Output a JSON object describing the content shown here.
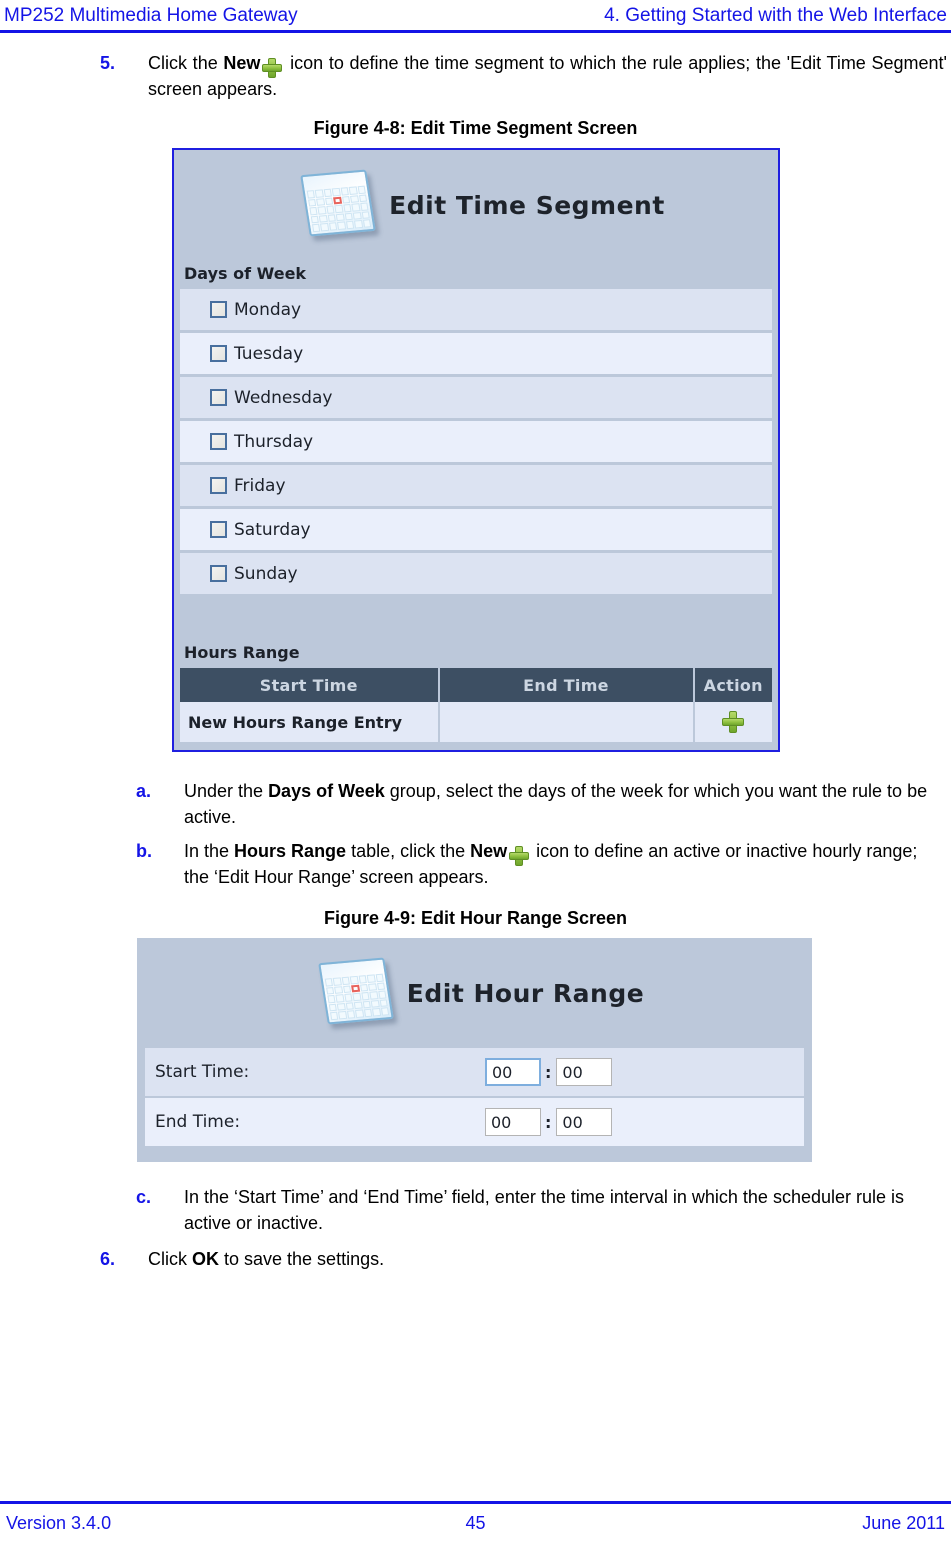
{
  "header": {
    "left": "MP252 Multimedia Home Gateway",
    "right": "4. Getting Started with the Web Interface"
  },
  "footer": {
    "version": "Version 3.4.0",
    "page_number": "45",
    "date": "June 2011"
  },
  "steps": {
    "step5": {
      "marker": "5.",
      "text_before_bold": "Click the ",
      "bold": "New",
      "text_after": " icon to define the time segment to which the rule applies; the 'Edit Time Segment' screen appears."
    },
    "step_a": {
      "marker": "a.",
      "text_before_bold": "Under the ",
      "bold": "Days of Week",
      "text_after": " group, select the days of the week for which you want the rule to be active."
    },
    "step_b": {
      "marker": "b.",
      "text_before_bold": "In the ",
      "bold1": "Hours Range",
      "text_mid": " table, click the ",
      "bold2": "New",
      "text_after": " icon to define an active or inactive hourly range; the ‘Edit Hour Range’ screen appears."
    },
    "step_c": {
      "marker": "c.",
      "text": "In the ‘Start Time’ and ‘End Time’ field, enter the time interval in which the scheduler rule is active or inactive."
    },
    "step6": {
      "marker": "6.",
      "text_before_bold": "Click ",
      "bold": "OK",
      "text_after": " to save the settings."
    }
  },
  "figure1": {
    "caption": "Figure 4-8: Edit Time Segment Screen",
    "screen_title": "Edit Time Segment",
    "icon": "calendar-icon",
    "days_group_title": "Days of Week",
    "days": [
      "Monday",
      "Tuesday",
      "Wednesday",
      "Thursday",
      "Friday",
      "Saturday",
      "Sunday"
    ],
    "hours_group_title": "Hours Range",
    "table": {
      "columns": [
        "Start Time",
        "End Time",
        "Action"
      ],
      "rows": [
        {
          "start": "New Hours Range Entry",
          "end": "",
          "action": "new-plus-icon"
        }
      ]
    }
  },
  "figure2": {
    "caption": "Figure 4-9: Edit Hour Range Screen",
    "screen_title": "Edit Hour Range",
    "icon": "calendar-icon",
    "fields": [
      {
        "label": "Start Time:",
        "hours": "00",
        "separator": ":",
        "minutes": "00"
      },
      {
        "label": "End Time:",
        "hours": "00",
        "separator": ":",
        "minutes": "00"
      }
    ]
  },
  "colors": {
    "header_blue": "#1414e6",
    "screen_bg": "#bcc8da",
    "table_header": "#3d4f63",
    "row_odd": "#dce3f2",
    "row_even": "#eaeffb",
    "plus_green": "#8ec03f"
  }
}
